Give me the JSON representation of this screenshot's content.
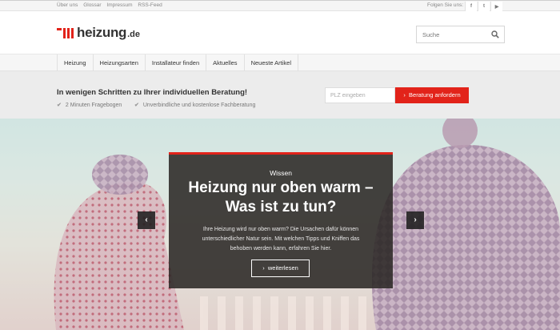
{
  "topbar": {
    "links": [
      "Über uns",
      "Glossar",
      "Impressum",
      "RSS-Feed"
    ],
    "follow_label": "Folgen Sie uns:",
    "social": [
      {
        "icon": "facebook-icon",
        "glyph": "f"
      },
      {
        "icon": "twitter-icon",
        "glyph": "t"
      },
      {
        "icon": "youtube-icon",
        "glyph": "▶"
      }
    ]
  },
  "header": {
    "logo_word": "heizung",
    "logo_tld": ".de",
    "brand_color": "#e2231a",
    "search": {
      "placeholder": "Suche",
      "icon": "search-icon"
    }
  },
  "nav": {
    "items": [
      "Heizung",
      "Heizungsarten",
      "Installateur finden",
      "Aktuelles",
      "Neueste Artikel"
    ]
  },
  "consult": {
    "heading": "In wenigen Schritten zu Ihrer individuellen Beratung!",
    "features": [
      "2 Minuten Fragebogen",
      "Unverbindliche und kostenlose Fachberatung"
    ],
    "plz_placeholder": "PLZ eingeben",
    "cta_label": "Beratung anfordern",
    "cta_icon": "chevron-right-icon"
  },
  "hero": {
    "kicker": "Wissen",
    "title": "Heizung nur oben warm – Was ist zu tun?",
    "teaser": "Ihre Heizung wird nur oben warm? Die Ursachen dafür können unterschiedlicher Natur sein. Mit welchen Tipps und Kniffen das behoben werden kann, erfahren Sie hier.",
    "more_label": "weiterlesen",
    "prev_glyph": "‹",
    "next_glyph": "›"
  }
}
